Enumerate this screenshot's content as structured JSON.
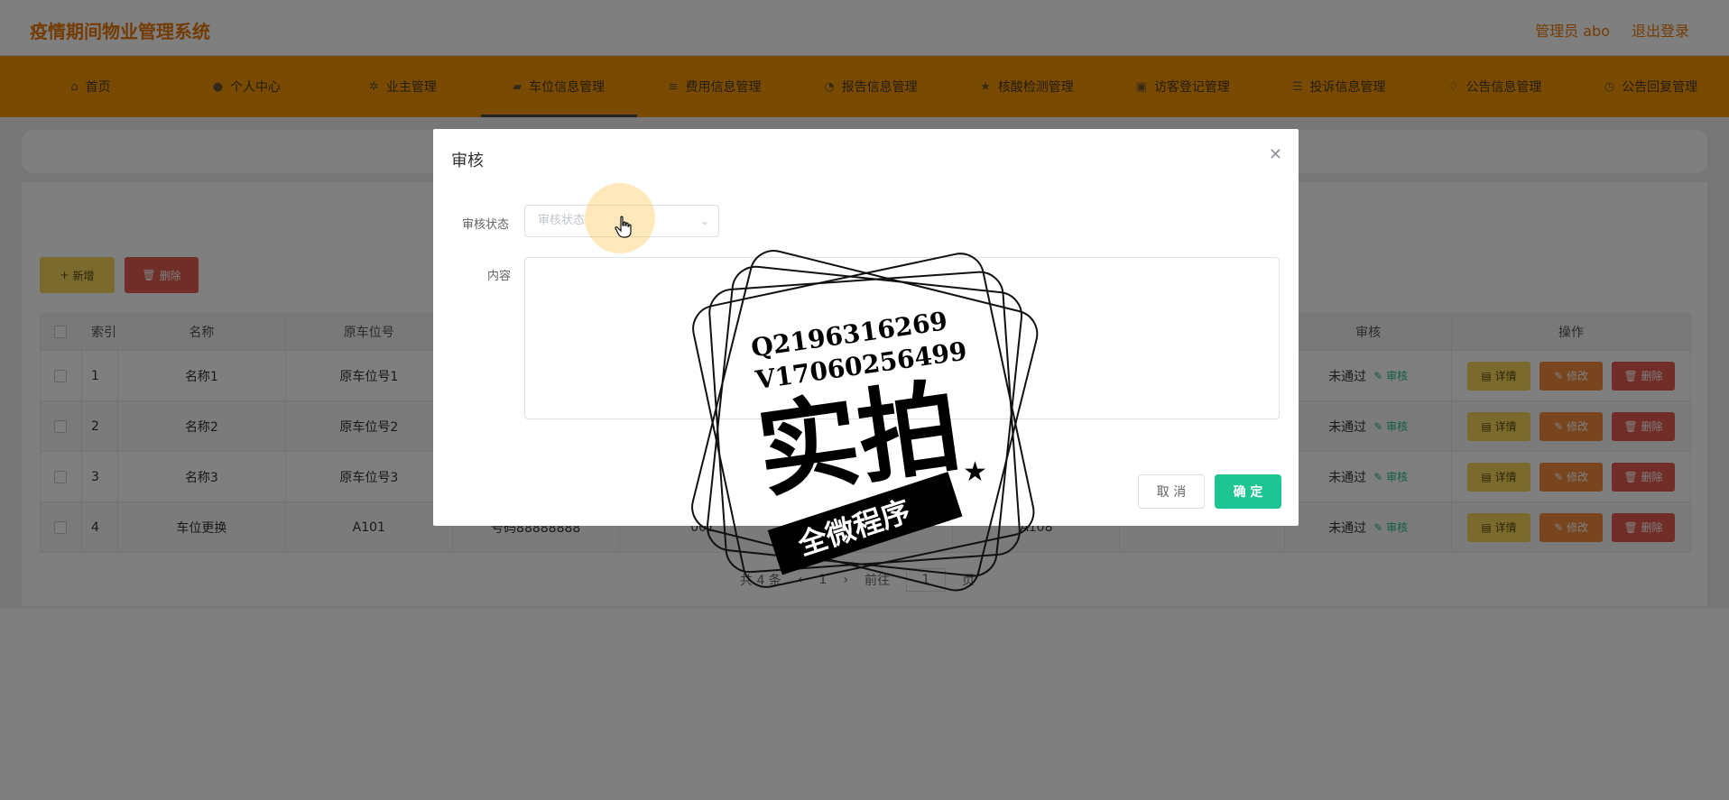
{
  "app": {
    "title": "疫情期间物业管理系统"
  },
  "user": {
    "name": "管理员 abo",
    "logout": "退出登录"
  },
  "nav": {
    "items": [
      {
        "label": "首页",
        "icon": "home-icon"
      },
      {
        "label": "个人中心",
        "icon": "user-icon"
      },
      {
        "label": "业主管理",
        "icon": "gear-icon"
      },
      {
        "label": "车位信息管理",
        "icon": "car-icon",
        "active": true
      },
      {
        "label": "费用信息管理",
        "icon": "list-icon"
      },
      {
        "label": "报告信息管理",
        "icon": "report-icon"
      },
      {
        "label": "核酸检测管理",
        "icon": "star-icon"
      },
      {
        "label": "访客登记管理",
        "icon": "visitor-icon"
      },
      {
        "label": "投诉信息管理",
        "icon": "menu-icon"
      },
      {
        "label": "公告信息管理",
        "icon": "bell-icon"
      },
      {
        "label": "公告回复管理",
        "icon": "reply-icon"
      }
    ]
  },
  "toolbar": {
    "add_label": "新增",
    "delete_label": "删除"
  },
  "table": {
    "headers": {
      "index": "索引",
      "name": "名称",
      "old_slot": "原车位号",
      "audit": "审核",
      "ops": "操作"
    },
    "rows": [
      {
        "index": "1",
        "name": "名称1",
        "old_slot": "原车位号1",
        "phone": "",
        "a": "",
        "b": "",
        "new_slot": "",
        "audit_status": "未通过"
      },
      {
        "index": "2",
        "name": "名称2",
        "old_slot": "原车位号2",
        "phone": "",
        "a": "",
        "b": "",
        "new_slot": "",
        "audit_status": "未通过"
      },
      {
        "index": "3",
        "name": "名称3",
        "old_slot": "原车位号3",
        "phone": "",
        "a": "",
        "b": "",
        "new_slot": "",
        "audit_status": "未通过"
      },
      {
        "index": "4",
        "name": "车位更换",
        "old_slot": "A101",
        "phone": "号码88888888",
        "a": "001",
        "b": "",
        "new_slot": "A108",
        "audit_status": "未通过"
      }
    ],
    "audit_link": "审核",
    "ops": {
      "detail": "详情",
      "edit": "修改",
      "delete": "删除"
    }
  },
  "pager": {
    "total": "共 4 条",
    "prev": "‹",
    "current": "1",
    "next": "›",
    "goto": "前往",
    "page_value": "1",
    "page_unit": "页"
  },
  "dialog": {
    "title": "审核",
    "status_label": "审核状态",
    "status_placeholder": "审核状态",
    "content_label": "内容",
    "cancel": "取 消",
    "confirm": "确 定"
  },
  "watermark": {
    "line1": "Q2196316269",
    "line2": "V17060256499",
    "big": "实拍",
    "ribbon": "全微程序"
  },
  "colors": {
    "brand": "#e8780a",
    "nav_bg": "#f39404",
    "confirm": "#1ec593",
    "detail": "#f6d55a",
    "edit": "#f08a3c",
    "danger": "#e35b4f"
  }
}
